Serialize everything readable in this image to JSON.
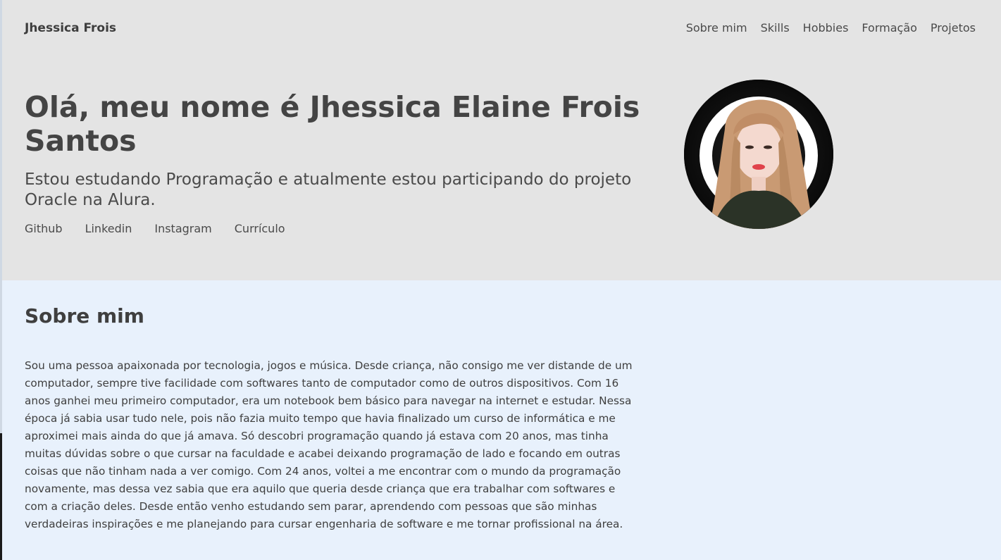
{
  "header": {
    "brand": "Jhessica Frois",
    "nav": [
      "Sobre mim",
      "Skills",
      "Hobbies",
      "Formação",
      "Projetos"
    ]
  },
  "hero": {
    "title": "Olá, meu nome é Jhessica Elaine Frois Santos",
    "subtitle": "Estou estudando Programação e atualmente estou participando do projeto Oracle na Alura.",
    "links": [
      "Github",
      "Linkedin",
      "Instagram",
      "Currículo"
    ]
  },
  "about": {
    "title": "Sobre mim",
    "text": "Sou uma pessoa apaixonada por tecnologia, jogos e música. Desde criança, não consigo me ver distande de um computador, sempre tive facilidade com softwares tanto de computador como de outros dispositivos. Com 16 anos ganhei meu primeiro computador, era um notebook bem básico para navegar na internet e estudar. Nessa época já sabia usar tudo nele, pois não fazia muito tempo que havia finalizado um curso de informática e me aproximei mais ainda do que já amava. Só descobri programação quando já estava com 20 anos, mas tinha muitas dúvidas sobre o que cursar na faculdade e acabei deixando programação de lado e focando em outras coisas que não tinham nada a ver comigo. Com 24 anos, voltei a me encontrar com o mundo da programação novamente, mas dessa vez sabia que era aquilo que queria desde criança que era trabalhar com softwares e com a criação deles. Desde então venho estudando sem parar, aprendendo com pessoas que são minhas verdadeiras inspirações e me planejando para cursar engenharia de software e me tornar profissional na área."
  },
  "colors": {
    "hero_bg": "#e4e4e4",
    "section_bg": "#e8f1fc",
    "text": "#444444"
  }
}
